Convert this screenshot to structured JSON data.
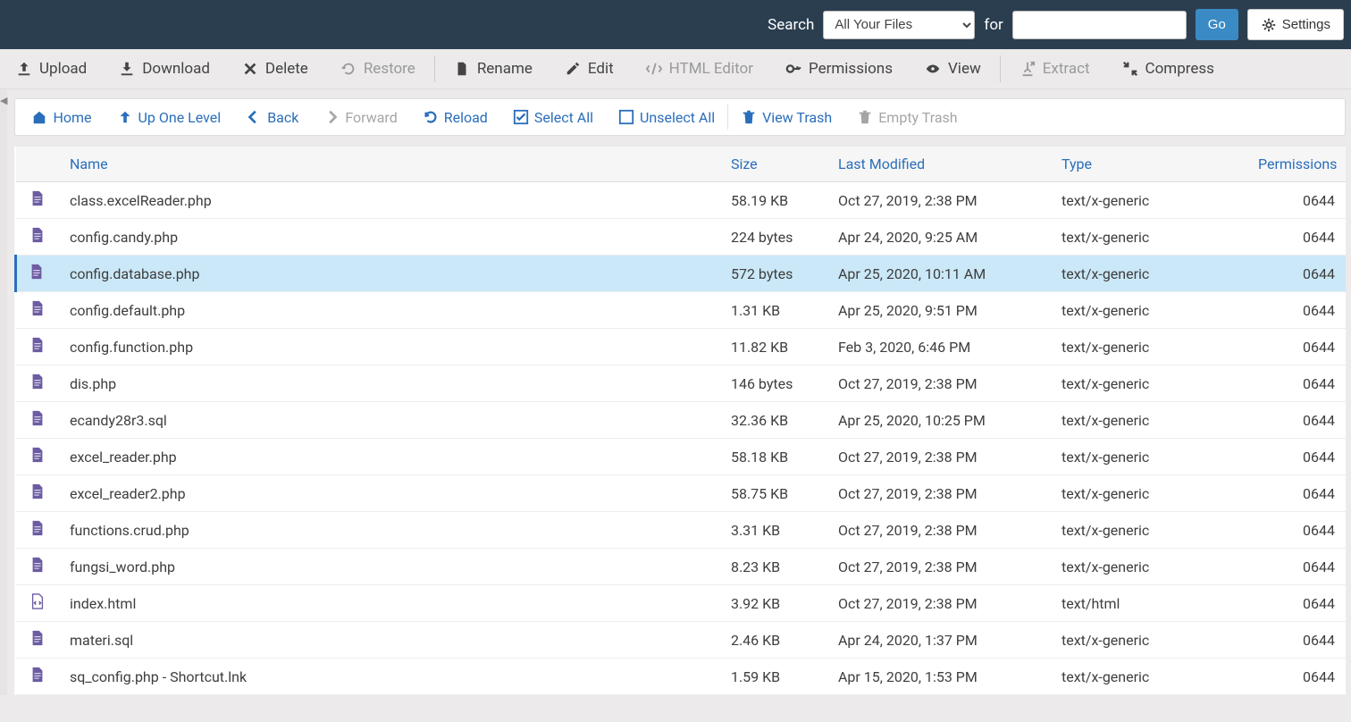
{
  "topbar": {
    "search_label": "Search",
    "scope_selected": "All Your Files",
    "for_label": "for",
    "go_label": "Go",
    "settings_label": "Settings",
    "search_value": ""
  },
  "toolbar": {
    "upload": "Upload",
    "download": "Download",
    "delete": "Delete",
    "restore": "Restore",
    "rename": "Rename",
    "edit": "Edit",
    "html_editor": "HTML Editor",
    "permissions": "Permissions",
    "view": "View",
    "extract": "Extract",
    "compress": "Compress"
  },
  "navbar": {
    "home": "Home",
    "up": "Up One Level",
    "back": "Back",
    "forward": "Forward",
    "reload": "Reload",
    "select_all": "Select All",
    "unselect_all": "Unselect All",
    "view_trash": "View Trash",
    "empty_trash": "Empty Trash"
  },
  "columns": {
    "name": "Name",
    "size": "Size",
    "modified": "Last Modified",
    "type": "Type",
    "permissions": "Permissions"
  },
  "files": [
    {
      "name": "class.excelReader.php",
      "size": "58.19 KB",
      "modified": "Oct 27, 2019, 2:38 PM",
      "type": "text/x-generic",
      "perm": "0644",
      "icon": "doc",
      "selected": false
    },
    {
      "name": "config.candy.php",
      "size": "224 bytes",
      "modified": "Apr 24, 2020, 9:25 AM",
      "type": "text/x-generic",
      "perm": "0644",
      "icon": "doc",
      "selected": false
    },
    {
      "name": "config.database.php",
      "size": "572 bytes",
      "modified": "Apr 25, 2020, 10:11 AM",
      "type": "text/x-generic",
      "perm": "0644",
      "icon": "doc",
      "selected": true
    },
    {
      "name": "config.default.php",
      "size": "1.31 KB",
      "modified": "Apr 25, 2020, 9:51 PM",
      "type": "text/x-generic",
      "perm": "0644",
      "icon": "doc",
      "selected": false
    },
    {
      "name": "config.function.php",
      "size": "11.82 KB",
      "modified": "Feb 3, 2020, 6:46 PM",
      "type": "text/x-generic",
      "perm": "0644",
      "icon": "doc",
      "selected": false
    },
    {
      "name": "dis.php",
      "size": "146 bytes",
      "modified": "Oct 27, 2019, 2:38 PM",
      "type": "text/x-generic",
      "perm": "0644",
      "icon": "doc",
      "selected": false
    },
    {
      "name": "ecandy28r3.sql",
      "size": "32.36 KB",
      "modified": "Apr 25, 2020, 10:25 PM",
      "type": "text/x-generic",
      "perm": "0644",
      "icon": "doc",
      "selected": false
    },
    {
      "name": "excel_reader.php",
      "size": "58.18 KB",
      "modified": "Oct 27, 2019, 2:38 PM",
      "type": "text/x-generic",
      "perm": "0644",
      "icon": "doc",
      "selected": false
    },
    {
      "name": "excel_reader2.php",
      "size": "58.75 KB",
      "modified": "Oct 27, 2019, 2:38 PM",
      "type": "text/x-generic",
      "perm": "0644",
      "icon": "doc",
      "selected": false
    },
    {
      "name": "functions.crud.php",
      "size": "3.31 KB",
      "modified": "Oct 27, 2019, 2:38 PM",
      "type": "text/x-generic",
      "perm": "0644",
      "icon": "doc",
      "selected": false
    },
    {
      "name": "fungsi_word.php",
      "size": "8.23 KB",
      "modified": "Oct 27, 2019, 2:38 PM",
      "type": "text/x-generic",
      "perm": "0644",
      "icon": "doc",
      "selected": false
    },
    {
      "name": "index.html",
      "size": "3.92 KB",
      "modified": "Oct 27, 2019, 2:38 PM",
      "type": "text/html",
      "perm": "0644",
      "icon": "code",
      "selected": false
    },
    {
      "name": "materi.sql",
      "size": "2.46 KB",
      "modified": "Apr 24, 2020, 1:37 PM",
      "type": "text/x-generic",
      "perm": "0644",
      "icon": "doc",
      "selected": false
    },
    {
      "name": "sq_config.php - Shortcut.lnk",
      "size": "1.59 KB",
      "modified": "Apr 15, 2020, 1:53 PM",
      "type": "text/x-generic",
      "perm": "0644",
      "icon": "doc",
      "selected": false
    }
  ]
}
